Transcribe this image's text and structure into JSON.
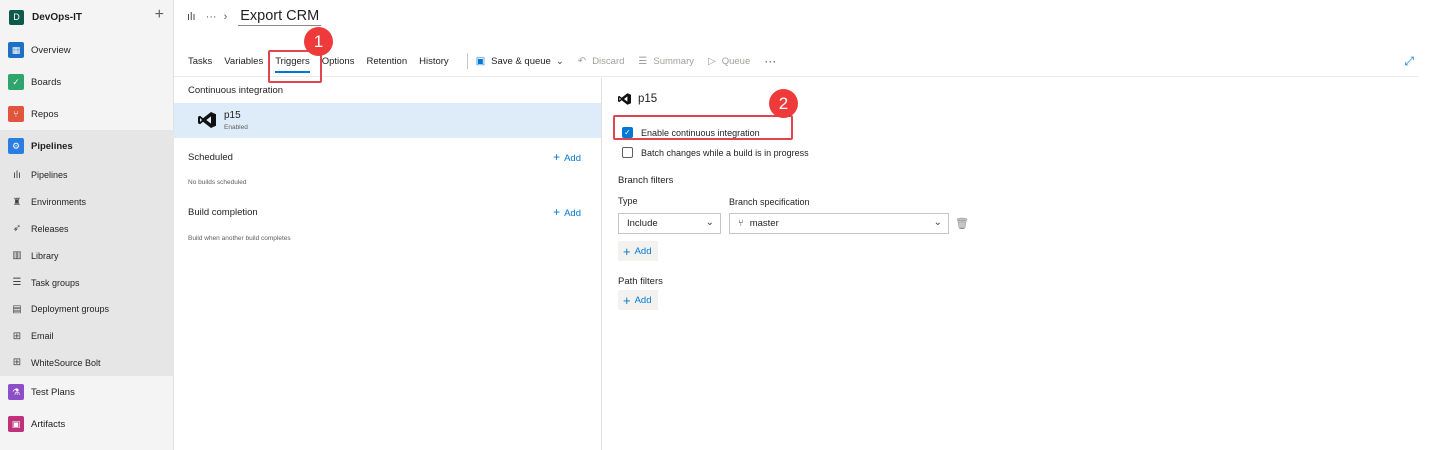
{
  "org": {
    "initial": "D",
    "name": "DevOps-IT",
    "add_icon": "plus-icon"
  },
  "nav": {
    "overview": "Overview",
    "boards": "Boards",
    "repos": "Repos",
    "pipelines": "Pipelines",
    "pipelines_sub": {
      "pipelines": "Pipelines",
      "environments": "Environments",
      "releases": "Releases",
      "library": "Library",
      "task_groups": "Task groups",
      "deployment_groups": "Deployment groups",
      "email": "Email",
      "whitesource": "WhiteSource Bolt"
    },
    "test_plans": "Test Plans",
    "artifacts": "Artifacts"
  },
  "header": {
    "dots": "···",
    "title": "Export CRM"
  },
  "tabs": {
    "tasks": "Tasks",
    "variables": "Variables",
    "triggers": "Triggers",
    "options": "Options",
    "retention": "Retention",
    "history": "History"
  },
  "toolbar": {
    "save_queue": "Save & queue",
    "discard": "Discard",
    "summary": "Summary",
    "queue": "Queue",
    "more": "···"
  },
  "callouts": {
    "one": "1",
    "two": "2"
  },
  "left": {
    "ci_header": "Continuous integration",
    "ci_name": "p15",
    "ci_status": "Enabled",
    "scheduled": "Scheduled",
    "scheduled_add": "Add",
    "scheduled_note": "No builds scheduled",
    "build_completion": "Build completion",
    "build_add": "Add",
    "build_note": "Build when another build completes"
  },
  "right": {
    "title": "p15",
    "enable_ci": "Enable continuous integration",
    "enable_ci_checked": true,
    "batch": "Batch changes while a build is in progress",
    "batch_checked": false,
    "branch_filters": "Branch filters",
    "type_label": "Type",
    "type_value": "Include",
    "branch_spec_label": "Branch specification",
    "branch_spec_value": "master",
    "branch_add": "Add",
    "path_filters": "Path filters",
    "path_add": "Add"
  },
  "colors": {
    "accent": "#0078d4",
    "highlight": "#e0454d",
    "callout": "#ee3a3a",
    "selected_row": "#deecf9"
  }
}
